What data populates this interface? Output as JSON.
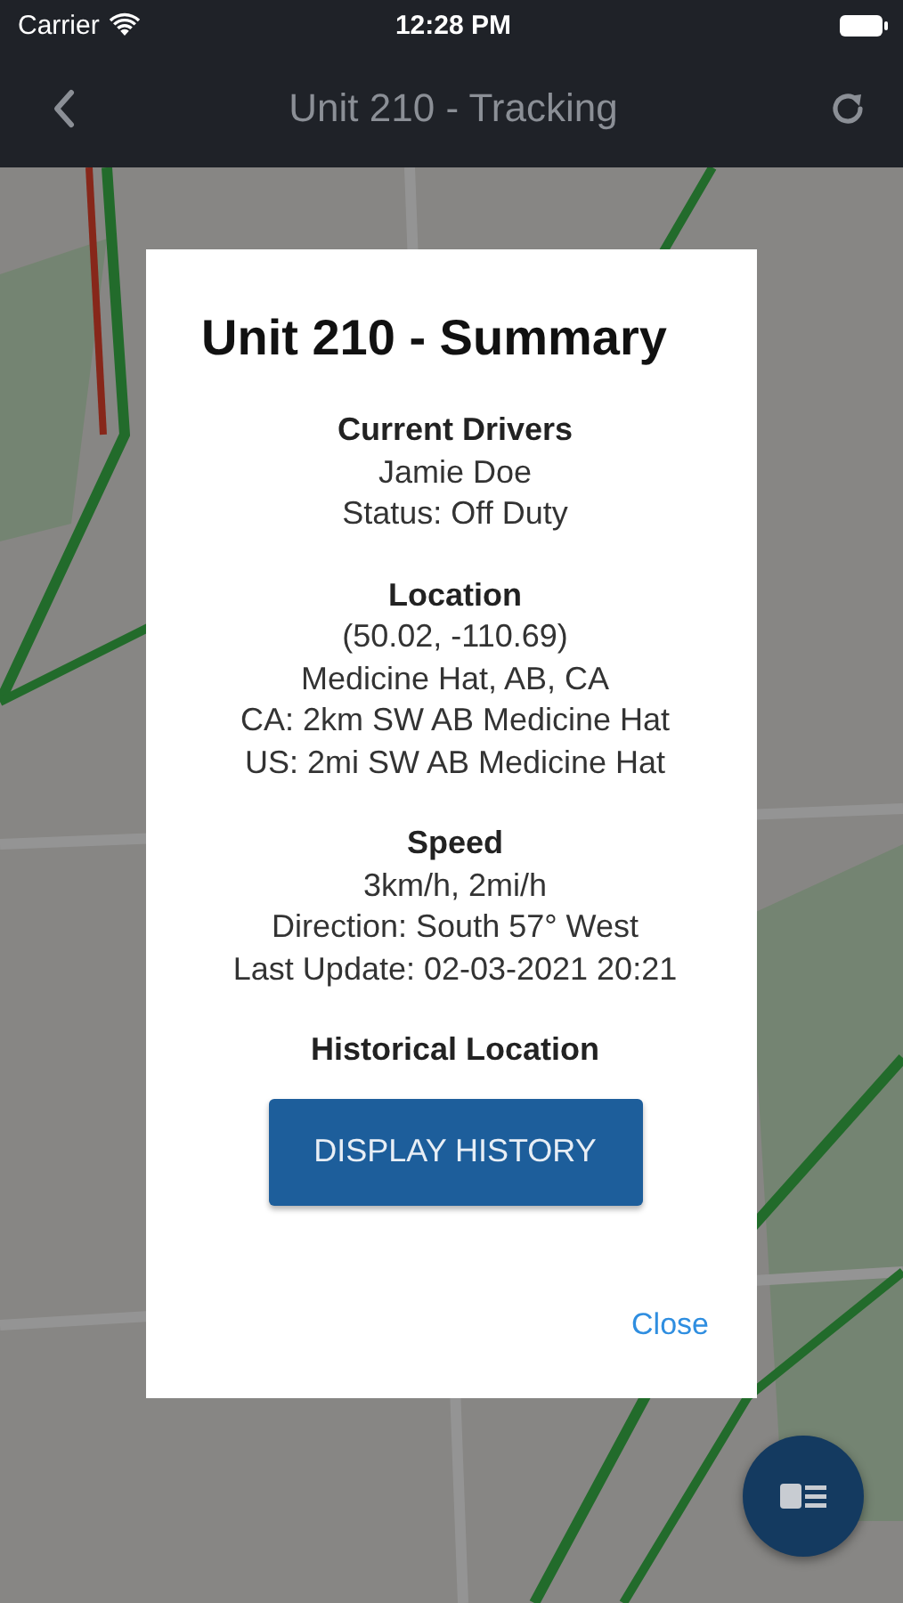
{
  "status_bar": {
    "carrier": "Carrier",
    "time": "12:28 PM"
  },
  "nav_bar": {
    "title": "Unit 210 - Tracking"
  },
  "dialog": {
    "title": "Unit 210 - Summary",
    "sections": [
      {
        "heading": "Current Drivers",
        "lines": [
          "Jamie Doe",
          "Status: Off Duty"
        ]
      },
      {
        "heading": "Location",
        "lines": [
          "(50.02, -110.69)",
          "Medicine Hat, AB, CA",
          "CA: 2km SW AB Medicine Hat",
          "US: 2mi SW AB Medicine Hat"
        ]
      },
      {
        "heading": "Speed",
        "lines": [
          "3km/h, 2mi/h",
          "Direction: South 57° West",
          "Last Update: 02-03-2021 20:21"
        ]
      },
      {
        "heading": "Historical Location"
      }
    ],
    "button": "DISPLAY HISTORY",
    "close": "Close"
  }
}
